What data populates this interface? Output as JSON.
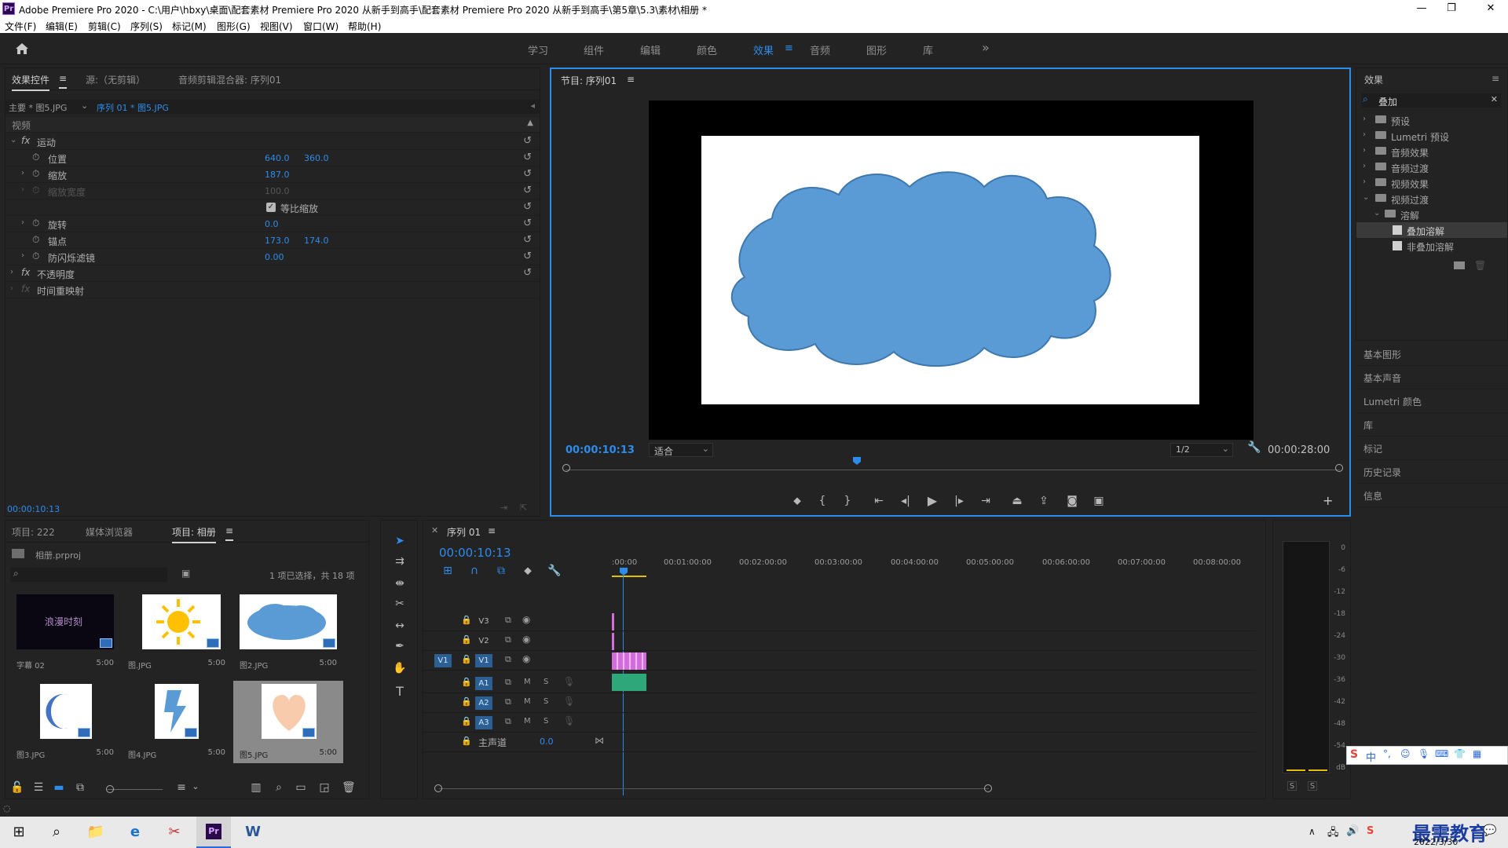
{
  "window": {
    "title": "Adobe Premiere Pro 2020 - C:\\用户\\hbxy\\桌面\\配套素材 Premiere Pro 2020 从新手到高手\\配套素材 Premiere Pro 2020 从新手到高手\\第5章\\5.3\\素材\\相册 *",
    "app_icon": "Pr"
  },
  "menu": [
    "文件(F)",
    "编辑(E)",
    "剪辑(C)",
    "序列(S)",
    "标记(M)",
    "图形(G)",
    "视图(V)",
    "窗口(W)",
    "帮助(H)"
  ],
  "workspaces": [
    {
      "label": "学习"
    },
    {
      "label": "组件"
    },
    {
      "label": "编辑"
    },
    {
      "label": "颜色"
    },
    {
      "label": "效果",
      "active": true
    },
    {
      "label": "音频"
    },
    {
      "label": "图形"
    },
    {
      "label": "库"
    }
  ],
  "workspace_overflow": "»",
  "effect_controls": {
    "tabs": [
      "效果控件",
      "源:（无剪辑）",
      "音频剪辑混合器: 序列01"
    ],
    "menu_glyph": "≡",
    "master": "主要 * 图5.JPG",
    "sequence_clip": "序列 01 * 图5.JPG",
    "section_video": "视频",
    "motion": "运动",
    "position": {
      "label": "位置",
      "x": "640.0",
      "y": "360.0"
    },
    "scale": {
      "label": "缩放",
      "value": "187.0"
    },
    "scale_width": {
      "label": "缩放宽度",
      "value": "100.0"
    },
    "uniform": "等比缩放",
    "rotation": {
      "label": "旋转",
      "value": "0.0"
    },
    "anchor": {
      "label": "锚点",
      "x": "173.0",
      "y": "174.0"
    },
    "antiflicker": {
      "label": "防闪烁滤镜",
      "value": "0.00"
    },
    "opacity": "不透明度",
    "time_remap": "时间重映射",
    "timecode": "00:00:10:13"
  },
  "program": {
    "title": "节目: 序列01",
    "menu_glyph": "≡",
    "timecode": "00:00:10:13",
    "fit": "适合",
    "resolution": "1/2",
    "duration": "00:00:28:00"
  },
  "effects_panel": {
    "title": "效果",
    "menu_glyph": "≡",
    "search_value": "叠加",
    "items": [
      {
        "label": "预设"
      },
      {
        "label": "Lumetri 预设"
      },
      {
        "label": "音频效果"
      },
      {
        "label": "音频过渡"
      },
      {
        "label": "视频效果"
      },
      {
        "label": "视频过渡",
        "open": true
      },
      {
        "label": "溶解",
        "open": true,
        "indent": 1
      },
      {
        "label": "叠加溶解",
        "indent": 2,
        "selected": true
      },
      {
        "label": "非叠加溶解",
        "indent": 2
      }
    ],
    "collapsed": [
      "基本图形",
      "基本声音",
      "Lumetri 颜色",
      "库",
      "标记",
      "历史记录",
      "信息"
    ]
  },
  "project": {
    "tabs": [
      "项目: 222",
      "媒体浏览器",
      "项目: 相册"
    ],
    "menu_glyph": "≡",
    "file": "相册.prproj",
    "selection_info": "1 项已选择，共 18 项",
    "items": [
      {
        "name": "字幕 02",
        "dur": "5:00",
        "kind": "title",
        "title_text": "浪漫时刻"
      },
      {
        "name": "图.JPG",
        "dur": "5:00",
        "kind": "sun"
      },
      {
        "name": "图2.JPG",
        "dur": "5:00",
        "kind": "cloud"
      },
      {
        "name": "图3.JPG",
        "dur": "5:00",
        "kind": "moon"
      },
      {
        "name": "图4.JPG",
        "dur": "5:00",
        "kind": "bolt"
      },
      {
        "name": "图5.JPG",
        "dur": "5:00",
        "kind": "heart",
        "selected": true
      }
    ]
  },
  "timeline": {
    "title": "序列 01",
    "menu_glyph": "≡",
    "timecode": "00:00:10:13",
    "ruler": [
      ":00:00",
      "00:01:00:00",
      "00:02:00:00",
      "00:03:00:00",
      "00:04:00:00",
      "00:05:00:00",
      "00:06:00:00",
      "00:07:00:00",
      "00:08:00:00"
    ],
    "tracks": [
      "V3",
      "V2",
      "V1",
      "A1",
      "A2",
      "A3"
    ],
    "source_patch_v": "V1",
    "mute_label": "M",
    "solo_label": "S",
    "master": "主声道",
    "master_value": "0.0"
  },
  "meter": {
    "labels": [
      "0",
      "-6",
      "-12",
      "-18",
      "-24",
      "-30",
      "-36",
      "-42",
      "-48",
      "-54",
      "dB"
    ],
    "solo": [
      "S",
      "S"
    ]
  },
  "taskbar": {
    "date": "2022/3/30",
    "watermark": "最需教育",
    "ime": "中"
  }
}
